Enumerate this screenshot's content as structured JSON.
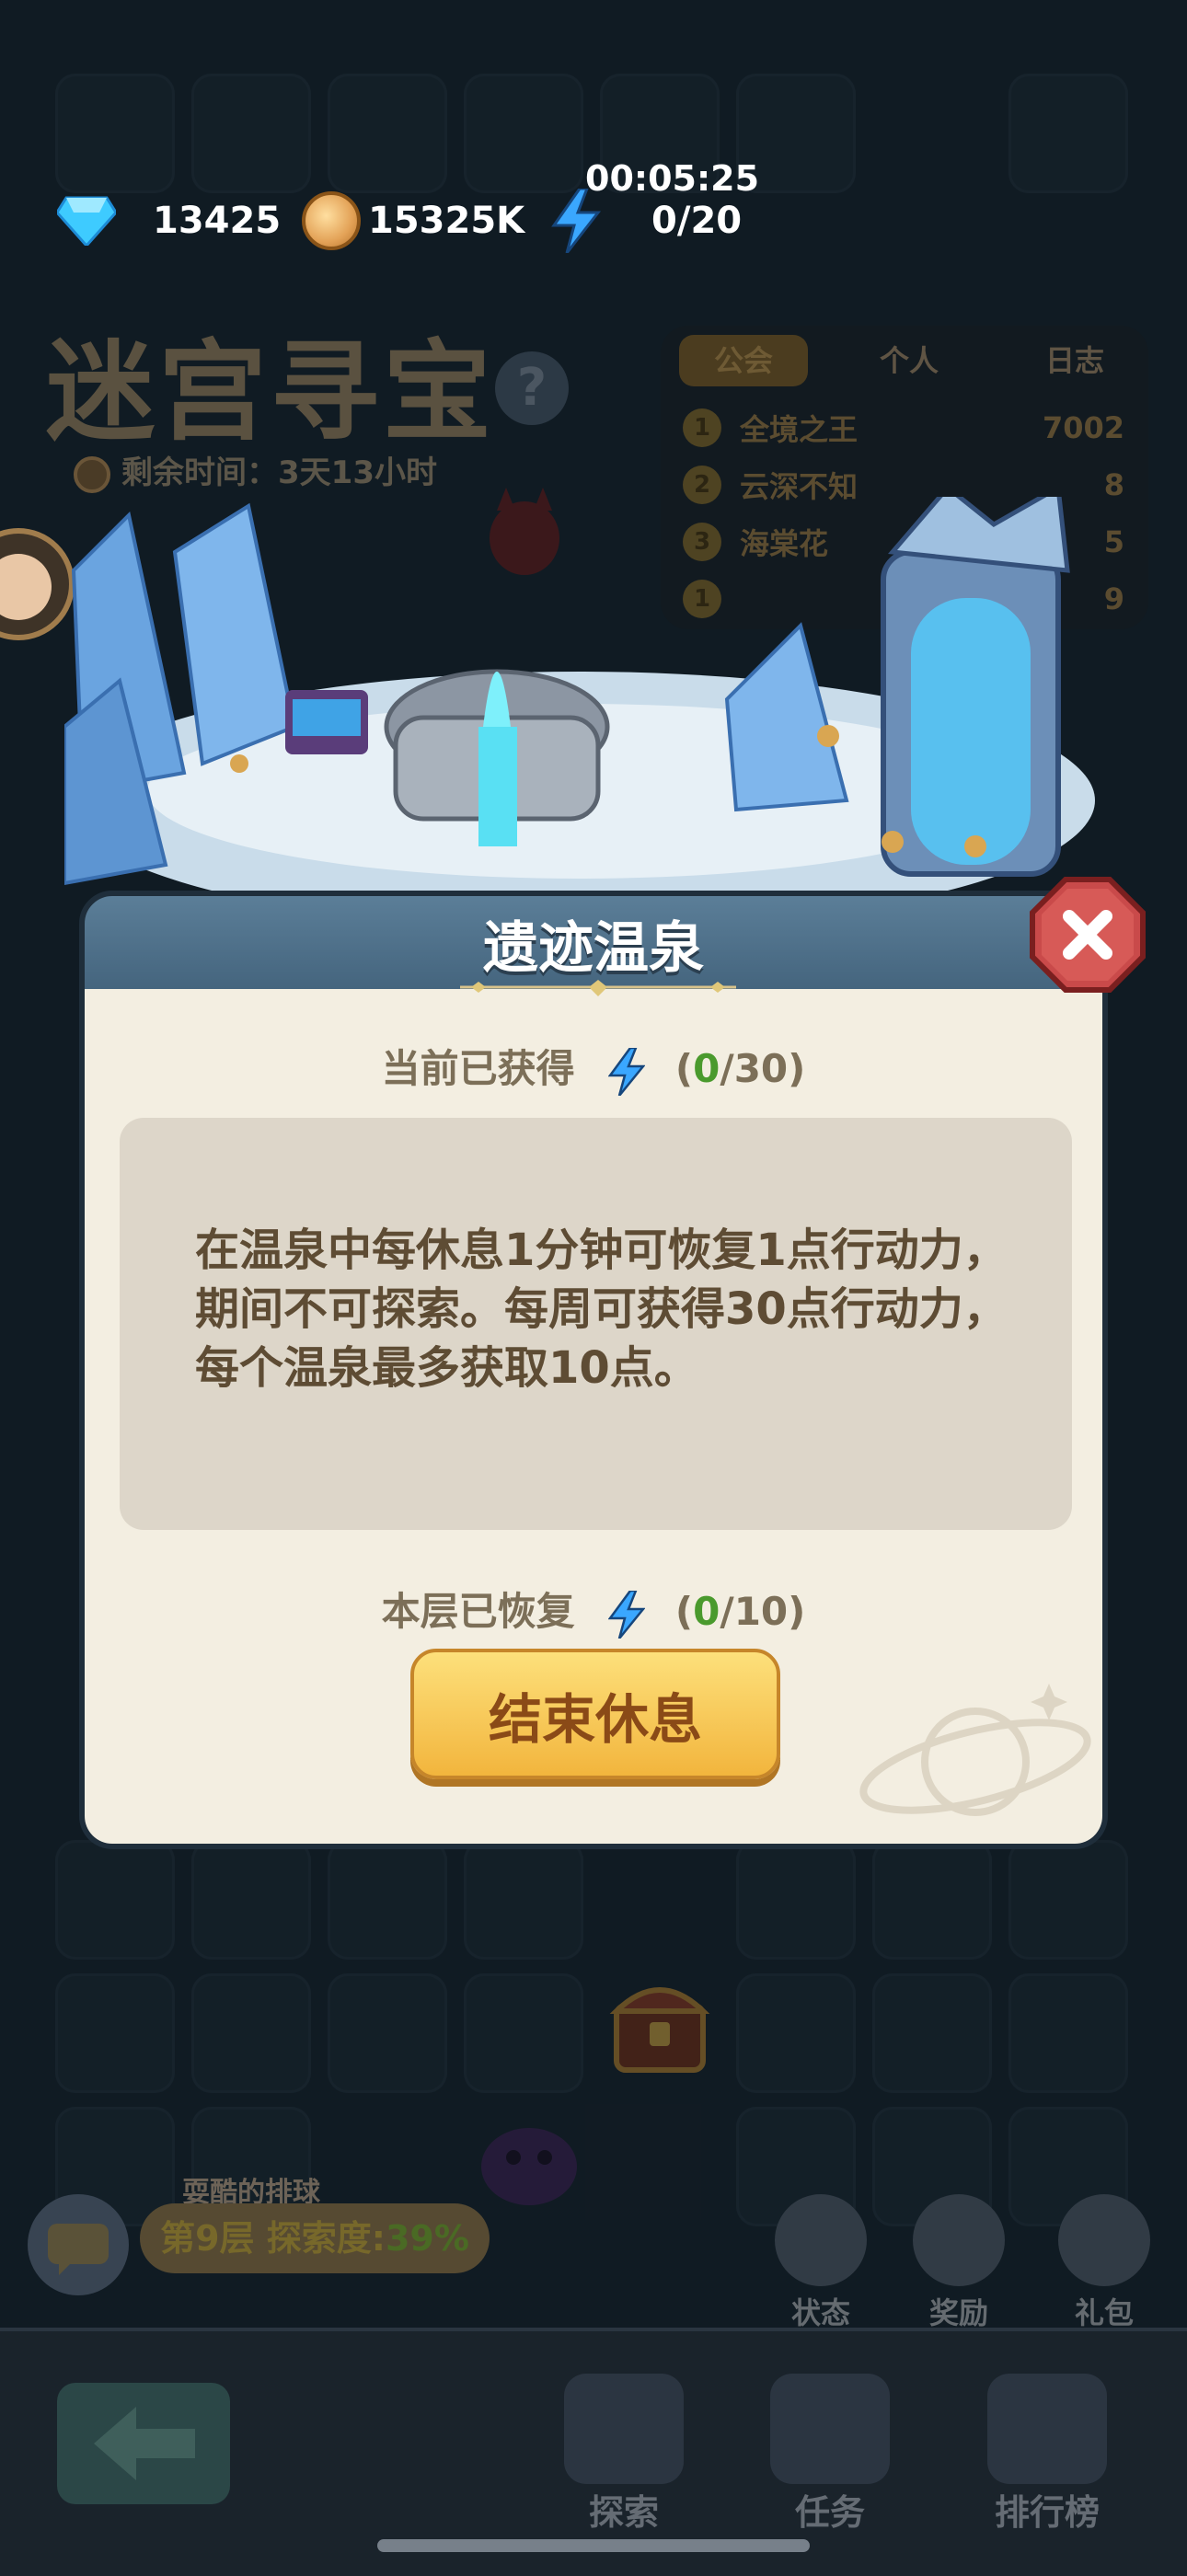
{
  "resources": {
    "gems": "13425",
    "coins": "15325K",
    "energy": "0/20",
    "timer": "00:05:25"
  },
  "background": {
    "title": "迷宫寻宝",
    "help_label": "?",
    "remaining_time": "剩余时间：3天13小时",
    "leaderboard": {
      "tabs": [
        "公会",
        "个人",
        "日志"
      ],
      "rows": [
        {
          "rank": "1",
          "name": "全境之王",
          "score": "7002"
        },
        {
          "rank": "2",
          "name": "云深不知",
          "score": "8"
        },
        {
          "rank": "3",
          "name": "海棠花",
          "score": "5"
        },
        {
          "rank": "1",
          "name": "",
          "score": "9"
        }
      ]
    }
  },
  "dialog": {
    "title": "遗迹温泉",
    "obtained_label": "当前已获得",
    "obtained_current": "0",
    "obtained_total": "/30)",
    "description": "在温泉中每休息1分钟可恢复1点行动力，期间不可探索。每周可获得30点行动力，每个温泉最多获取10点。",
    "floor_label": "本层已恢复",
    "floor_current": "0",
    "floor_total": "/10)",
    "paren_open": "(",
    "end_rest_button": "结束休息"
  },
  "lower": {
    "player_name": "耍酷的排球",
    "floor_text": "第9层 探索度:",
    "progress": "39%",
    "side_buttons": [
      "状态",
      "奖励",
      "礼包"
    ]
  },
  "nav": {
    "items": [
      "探索",
      "任务",
      "排行榜"
    ]
  },
  "colors": {
    "accent_green": "#4a9a2d",
    "button_gold": "#f2b53d",
    "dialog_header": "#4f7089",
    "close_red": "#c94a4a"
  }
}
